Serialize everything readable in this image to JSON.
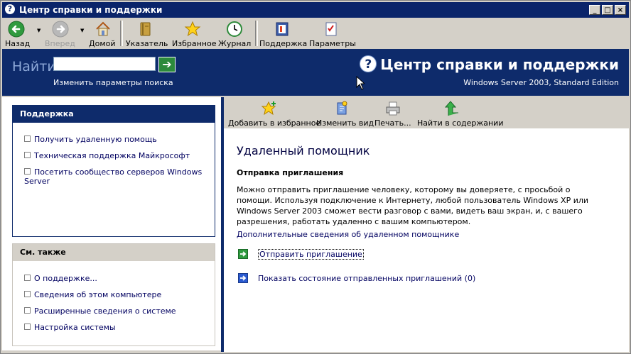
{
  "window": {
    "title": "Центр справки и поддержки",
    "controls": [
      "_",
      "□",
      "×"
    ]
  },
  "toolbar": {
    "back": "Назад",
    "forward": "Вперед",
    "home": "Домой",
    "index": "Указатель",
    "favorites": "Избранное",
    "history": "Журнал",
    "support": "Поддержка",
    "options": "Параметры"
  },
  "search": {
    "label": "Найти",
    "value": "",
    "go_symbol": "➔",
    "options_link": "Изменить параметры поиска"
  },
  "banner": {
    "title": "Центр справки и поддержки",
    "subtitle": "Windows Server 2003, Standard Edition"
  },
  "support_box": {
    "heading": "Поддержка",
    "links": [
      "Получить удаленную помощь",
      "Техническая поддержка Майкрософт",
      "Посетить сообщество серверов Windows Server"
    ]
  },
  "see_also_box": {
    "heading": "См. также",
    "links": [
      "О поддержке...",
      "Сведения об этом компьютере",
      "Расширенные сведения о системе",
      "Настройка системы"
    ]
  },
  "content_toolbar": {
    "add_favorite": "Добавить в избранное",
    "change_view": "Изменить вид",
    "print": "Печать...",
    "find_in_contents": "Найти в содержании"
  },
  "content": {
    "title": "Удаленный помощник",
    "subtitle": "Отправка приглашения",
    "paragraph": "Можно отправить приглашение человеку, которому вы доверяете, с просьбой о помощи. Используя подключение к Интернету, любой пользователь Windows XP или Windows Server 2003 сможет вести разговор с вами, видеть ваш экран, и, с вашего разрешения, работать удаленно с вашим компьютером.",
    "more_link": "Дополнительные сведения об удаленном помощнике",
    "actions": [
      "Отправить приглашение",
      "Показать состояние отправленных приглашений (0)"
    ]
  },
  "colors": {
    "titlebar": "#0a246a",
    "banner": "#0e2b6b",
    "face": "#d4d0c8",
    "link": "#000060"
  }
}
